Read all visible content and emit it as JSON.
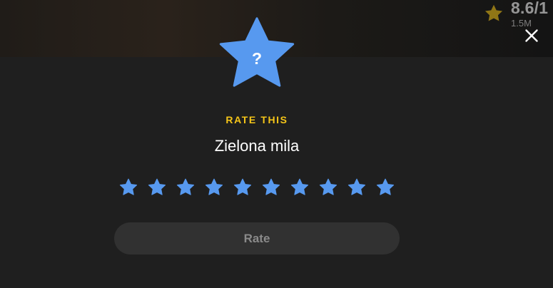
{
  "background": {
    "imdb_rating": "8.6/1",
    "vote_count": "1.5M"
  },
  "close": {
    "icon": "close-icon"
  },
  "hero": {
    "icon": "star-question-icon",
    "glyph": "?",
    "color": "#5799ef"
  },
  "rate_panel": {
    "kicker": "RATE THIS",
    "title": "Zielona mila",
    "kicker_color": "#f5c518",
    "stars": [
      {
        "value": 1
      },
      {
        "value": 2
      },
      {
        "value": 3
      },
      {
        "value": 4
      },
      {
        "value": 5
      },
      {
        "value": 6
      },
      {
        "value": 7
      },
      {
        "value": 8
      },
      {
        "value": 9
      },
      {
        "value": 10
      }
    ],
    "star_color": "#5799ef",
    "button_label": "Rate"
  }
}
